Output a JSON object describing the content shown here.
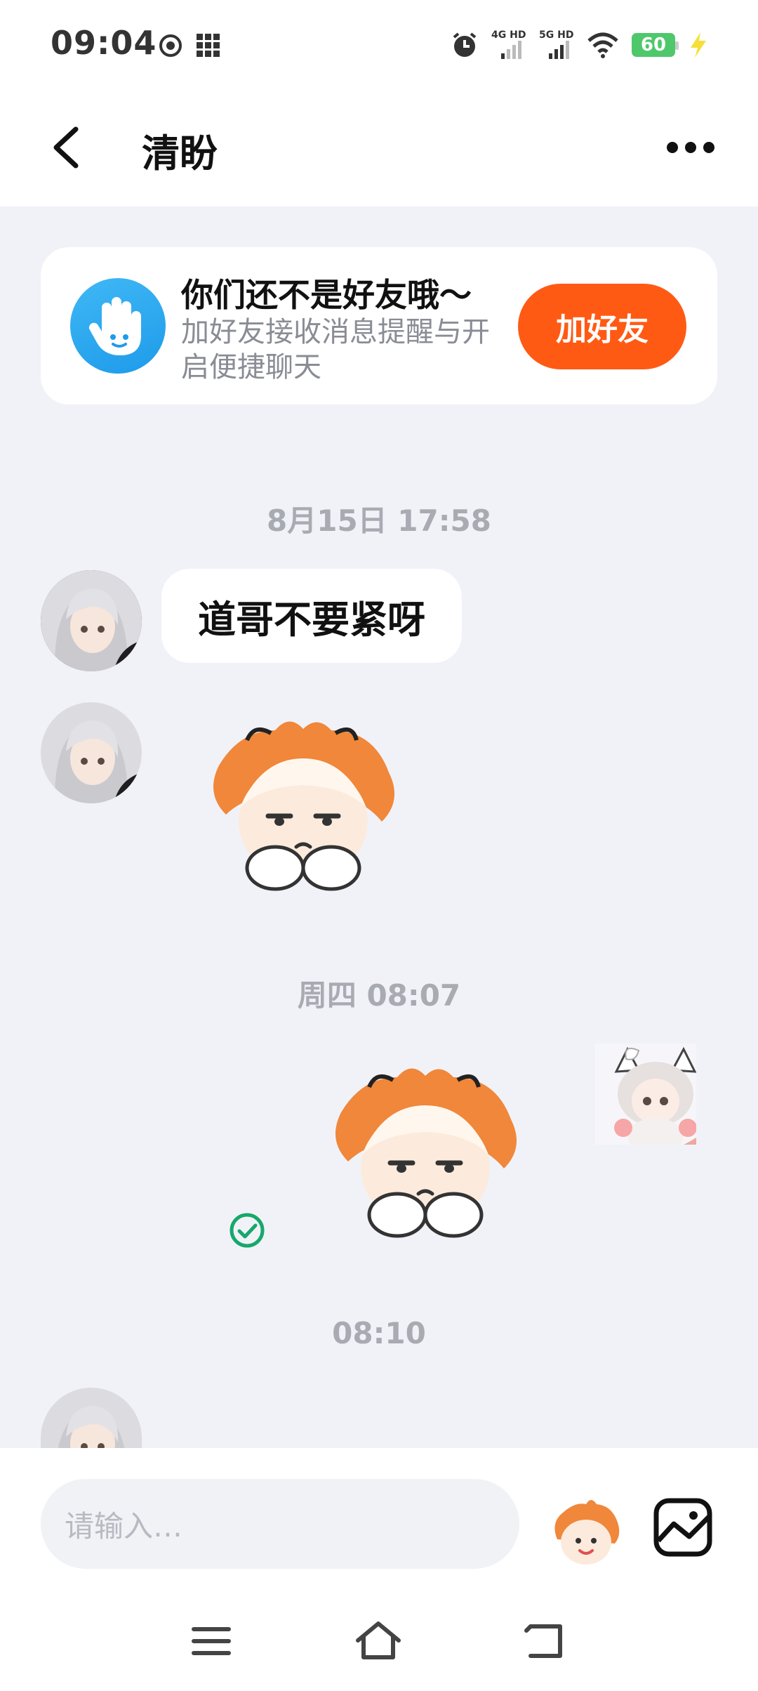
{
  "status_bar": {
    "time": "09:04",
    "network_1": "4G HD",
    "network_2": "5G HD",
    "battery": "60",
    "icons": [
      "app-icon",
      "grid-icon",
      "alarm-icon",
      "signal-icon",
      "wifi-icon",
      "battery-icon",
      "charging-icon"
    ]
  },
  "header": {
    "title": "清盼",
    "icons": [
      "back-icon",
      "more-icon"
    ]
  },
  "friend_banner": {
    "title": "你们还不是好友哦～",
    "description": "加好友接收消息提醒与开启便捷聊天",
    "add_button": "加好友",
    "icon": "hand-wave-icon"
  },
  "chat": {
    "messages": [
      {
        "type": "timestamp",
        "text": "8月15日 17:58"
      },
      {
        "type": "text",
        "sender": "other",
        "text": "道哥不要紧呀"
      },
      {
        "type": "sticker",
        "sender": "other",
        "sticker": "orange-hair-character-sticker"
      },
      {
        "type": "timestamp",
        "text": "周四 08:07"
      },
      {
        "type": "sticker",
        "sender": "self",
        "sticker": "orange-hair-character-sticker",
        "status": "read"
      },
      {
        "type": "timestamp",
        "text": "08:10"
      }
    ]
  },
  "input_bar": {
    "placeholder": "请输入…",
    "icons": [
      "sticker-icon",
      "image-icon"
    ]
  },
  "nav_bar": {
    "icons": [
      "menu-icon",
      "home-icon",
      "back-nav-icon"
    ]
  },
  "colors": {
    "accent": "#FF5A14",
    "background": "#F1F2F8",
    "banner_icon": "#1E9BEA",
    "read_check": "#16A86A"
  }
}
